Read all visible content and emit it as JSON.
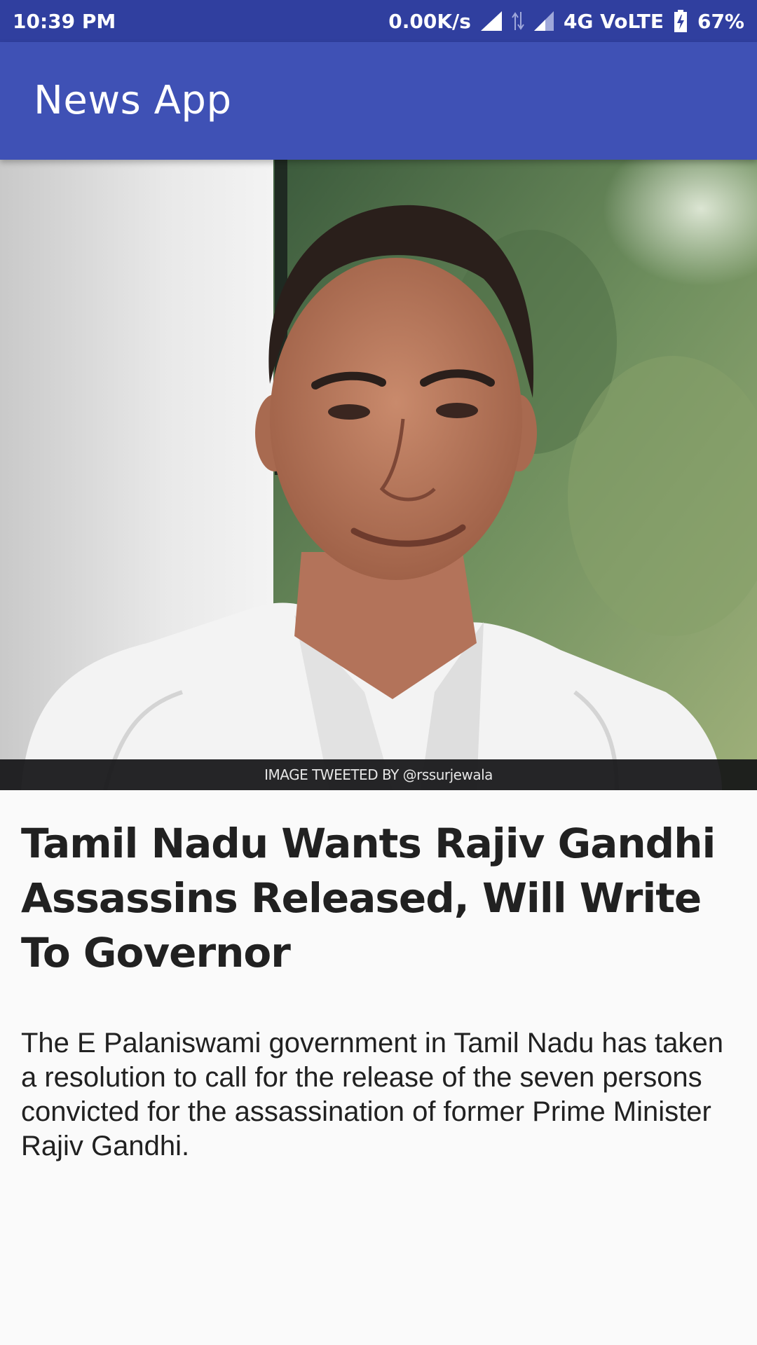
{
  "status_bar": {
    "time": "10:39 PM",
    "network_speed": "0.00K/s",
    "network_type": "4G VoLTE",
    "battery": "67%",
    "icons": [
      "signal-icon",
      "data-arrows-icon",
      "signal-icon",
      "battery-charging-icon"
    ]
  },
  "app_bar": {
    "title": "News App",
    "color": "#3f51b5",
    "status_color": "#303f9f"
  },
  "article": {
    "image_caption": "IMAGE TWEETED BY @rssurjewala",
    "headline": "Tamil Nadu Wants Rajiv Gandhi Assassins Released, Will Write To Governor",
    "summary": "The E Palaniswami government in Tamil Nadu has taken a resolution to call for the release of the seven persons convicted for the assassination of former Prime Minister Rajiv Gandhi."
  }
}
